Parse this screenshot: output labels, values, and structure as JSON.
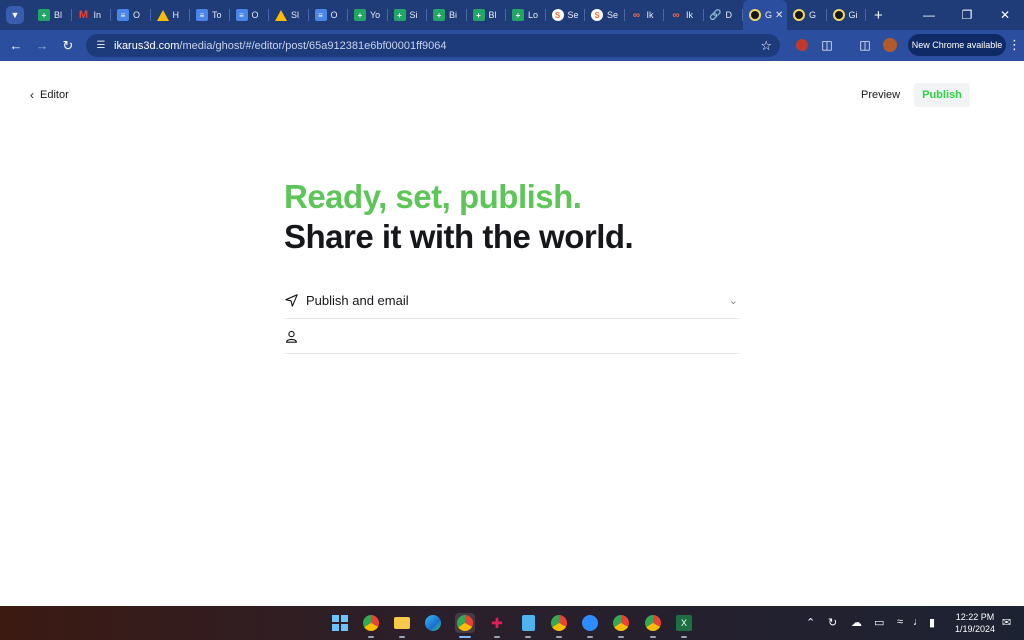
{
  "browser": {
    "tabs": [
      {
        "label": "Bl",
        "favicon": "sheets-icon"
      },
      {
        "label": "In",
        "favicon": "gmail-icon"
      },
      {
        "label": "O",
        "favicon": "docs-icon"
      },
      {
        "label": "H",
        "favicon": "drive-icon"
      },
      {
        "label": "To",
        "favicon": "docs-icon"
      },
      {
        "label": "O",
        "favicon": "docs-icon"
      },
      {
        "label": "Sl",
        "favicon": "drive-icon"
      },
      {
        "label": "O",
        "favicon": "docs-icon"
      },
      {
        "label": "Yo",
        "favicon": "sheets-icon"
      },
      {
        "label": "Si",
        "favicon": "sheets-icon"
      },
      {
        "label": "Bi",
        "favicon": "sheets-icon"
      },
      {
        "label": "Bl",
        "favicon": "sheets-icon"
      },
      {
        "label": "Lo",
        "favicon": "sheets-icon"
      },
      {
        "label": "Se",
        "favicon": "semrush-icon"
      },
      {
        "label": "Se",
        "favicon": "semrush-icon"
      },
      {
        "label": "Ik",
        "favicon": "ikarus-icon"
      },
      {
        "label": "Ik",
        "favicon": "ikarus-icon"
      },
      {
        "label": "D",
        "favicon": "link-icon"
      },
      {
        "label": "G",
        "favicon": "ghost-icon",
        "active": true
      },
      {
        "label": "G",
        "favicon": "ghost-icon"
      },
      {
        "label": "Gi",
        "favicon": "ghost-icon"
      }
    ],
    "url_host": "ikarus3d.com",
    "url_path": "/media/ghost/#/editor/post/65a912381e6bf00001ff9064",
    "update_button": "New Chrome available"
  },
  "editor": {
    "back_label": "Editor",
    "preview_label": "Preview",
    "publish_label": "Publish",
    "headline_line1": "Ready, set, publish.",
    "headline_line2": "Share it with the world.",
    "option_publish_type": "Publish and email",
    "option_audience": ""
  },
  "taskbar": {
    "time": "12:22 PM",
    "date": "1/19/2024"
  },
  "colors": {
    "ghost_green": "#30cf43",
    "headline_green": "#5ec659",
    "chrome_frame": "#1f3b78"
  }
}
